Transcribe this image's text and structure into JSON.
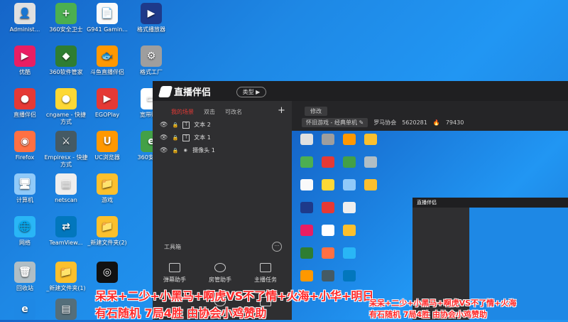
{
  "desktop": {
    "icons": [
      {
        "label": "Administ...",
        "color": "#e0e0e0",
        "glyph": "👤"
      },
      {
        "label": "360安全卫士",
        "color": "#4caf50",
        "glyph": "+"
      },
      {
        "label": "G941 Gamin...",
        "color": "#fafafa",
        "glyph": "📄"
      },
      {
        "label": "格式播放器",
        "color": "#1e3a8a",
        "glyph": "▶"
      },
      {
        "label": "优酷",
        "color": "#e91e63",
        "glyph": "▶"
      },
      {
        "label": "360软件管家",
        "color": "#2e7d32",
        "glyph": "◆"
      },
      {
        "label": "斗鱼直播伴侣",
        "color": "#ff9800",
        "glyph": "🐟"
      },
      {
        "label": "格式工厂",
        "color": "#9e9e9e",
        "glyph": "⚙"
      },
      {
        "label": "直播伴侣",
        "color": "#e53935",
        "glyph": "●"
      },
      {
        "label": "cngame - 快捷方式",
        "color": "#fdd835",
        "glyph": "●"
      },
      {
        "label": "EGOPlay",
        "color": "#e53935",
        "glyph": "▶"
      },
      {
        "label": "宽带账号",
        "color": "#ffffff",
        "glyph": "▭"
      },
      {
        "label": "Firefox",
        "color": "#ff7043",
        "glyph": "◉"
      },
      {
        "label": "Empiresx - 快捷方式",
        "color": "#455a64",
        "glyph": "⚔"
      },
      {
        "label": "UC浏览器",
        "color": "#ff9800",
        "glyph": "U"
      },
      {
        "label": "360安全...",
        "color": "#43a047",
        "glyph": "e"
      },
      {
        "label": "计算机",
        "color": "#90caf9",
        "glyph": "🖥"
      },
      {
        "label": "netscan",
        "color": "#eeeeee",
        "glyph": "▦"
      },
      {
        "label": "游戏",
        "color": "#fbc02d",
        "glyph": "📁"
      },
      {
        "label": "网络",
        "color": "#29b6f6",
        "glyph": "🌐"
      },
      {
        "label": "TeamView...",
        "color": "#0277bd",
        "glyph": "⇄"
      },
      {
        "label": "_新建文件夹(2)",
        "color": "#fbc02d",
        "glyph": "📁"
      },
      {
        "label": "回收站",
        "color": "#b0bec5",
        "glyph": "🗑"
      },
      {
        "label": "_新建文件夹(1)",
        "color": "#fbc02d",
        "glyph": "📁"
      },
      {
        "label": "",
        "color": "#111111",
        "glyph": "◎"
      },
      {
        "label": "",
        "color": "#1e88e5",
        "glyph": "e"
      },
      {
        "label": "",
        "color": "#546e7a",
        "glyph": "▤"
      }
    ]
  },
  "app": {
    "logo": "直播伴侣",
    "type_button": "类型 ▶",
    "tabs": [
      "我的场景",
      "双击",
      "可改名"
    ],
    "add_icon": "+",
    "scenes": [
      {
        "label": "文本 2",
        "glyph": "T"
      },
      {
        "label": "文本 1",
        "glyph": "T"
      },
      {
        "label": "摄像头 1",
        "glyph": "◉"
      }
    ],
    "toolbox_title": "工具箱",
    "toolbox_more": "···",
    "tools": [
      "弹幕助手",
      "房管助手",
      "主播任务"
    ],
    "edit_button": "修改",
    "category": "怀旧游戏 - 经典单机 ✎",
    "streamer": "罗马协会",
    "room_id": "5620281",
    "fans": "79430",
    "nested_title": "直播伴侣"
  },
  "overlay": {
    "line1": "呆呆+二少+小黑马+啊虎VS不了情+火海+小华+明日",
    "line2": "有石随机 7局4胜 由协会小鸡赞助",
    "line1_small": "呆呆+二少+小黑马+啊虎VS不了情+火海",
    "line2_small": "有石随机 7局4胜 由协会小鸡赞助"
  }
}
